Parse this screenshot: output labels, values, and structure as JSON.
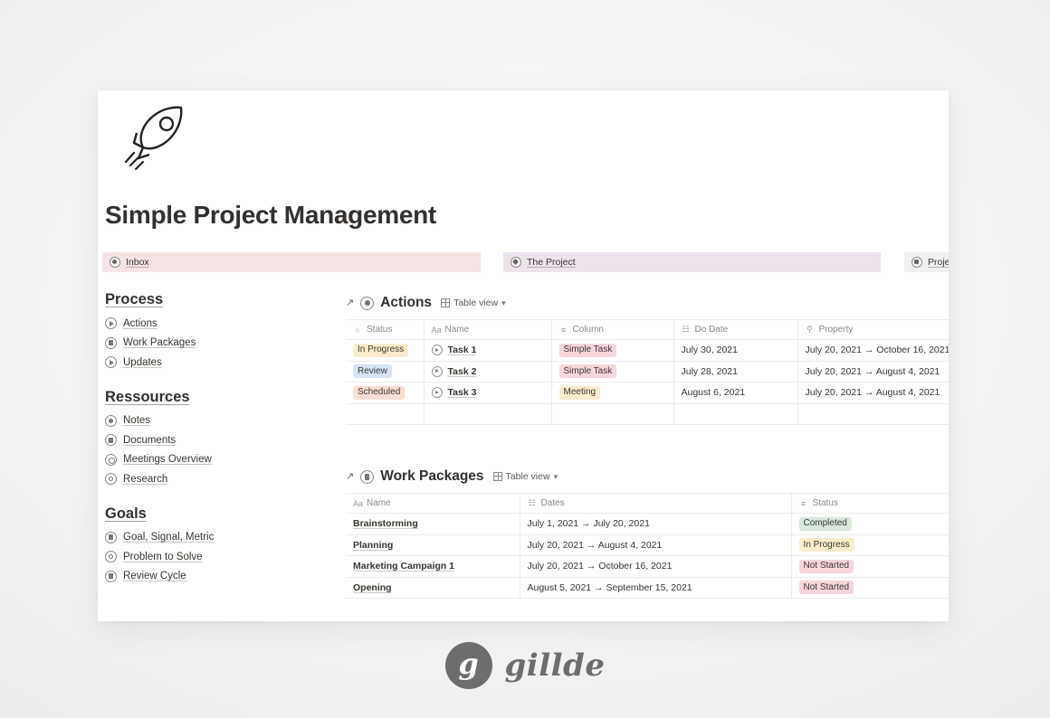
{
  "page": {
    "title": "Simple Project Management",
    "hero_icon": "rocket-icon"
  },
  "callouts": [
    {
      "label": "Inbox",
      "icon": "circle-eye-icon",
      "bg": "#f6e4e4"
    },
    {
      "label": "The Project",
      "icon": "circle-target-icon",
      "bg": "#eee3ec"
    },
    {
      "label": "Projec",
      "icon": "circle-person-icon",
      "bg": "#eef0f2"
    }
  ],
  "sidebar": {
    "groups": [
      {
        "heading": "Process",
        "items": [
          {
            "label": "Actions",
            "icon": "circle-play-icon"
          },
          {
            "label": "Work Packages",
            "icon": "circle-p-icon"
          },
          {
            "label": "Updates",
            "icon": "circle-triangle-icon"
          }
        ]
      },
      {
        "heading": "Ressources",
        "items": [
          {
            "label": "Notes",
            "icon": "circle-note-icon"
          },
          {
            "label": "Documents",
            "icon": "circle-document-icon"
          },
          {
            "label": "Meetings Overview",
            "icon": "circle-clock-icon"
          },
          {
            "label": "Research",
            "icon": "circle-target-icon"
          }
        ]
      },
      {
        "heading": "Goals",
        "items": [
          {
            "label": "Goal, Signal, Metric",
            "icon": "circle-document-icon"
          },
          {
            "label": "Problem to Solve",
            "icon": "circle-target-icon"
          },
          {
            "label": "Review Cycle",
            "icon": "circle-r-icon"
          }
        ]
      }
    ]
  },
  "databases": [
    {
      "title": "Actions",
      "open_icon": "arrow-up-right-icon",
      "db_icon": "circle-play-icon",
      "view": {
        "label": "Table view",
        "icon": "grid-icon",
        "chevron": "chevron-down-icon"
      },
      "columns": [
        {
          "label": "Status",
          "glyph": "○"
        },
        {
          "label": "Name",
          "glyph": "Aa"
        },
        {
          "label": "Column",
          "glyph": "≡"
        },
        {
          "label": "Do Date",
          "glyph": "☷"
        },
        {
          "label": "Property",
          "glyph": "⚲"
        }
      ],
      "rows": [
        {
          "status": {
            "text": "In Progress",
            "tag": "tag-inprogress"
          },
          "name": "Task 1",
          "column": {
            "text": "Simple Task",
            "tag": "tag-simpletask"
          },
          "do_date": "July 30, 2021",
          "property": "July 20, 2021 → October 16, 2021"
        },
        {
          "status": {
            "text": "Review",
            "tag": "tag-review"
          },
          "name": "Task 2",
          "column": {
            "text": "Simple Task",
            "tag": "tag-simpletask"
          },
          "do_date": "July 28, 2021",
          "property": "July 20, 2021 → August 4, 2021"
        },
        {
          "status": {
            "text": "Scheduled",
            "tag": "tag-scheduled"
          },
          "name": "Task 3",
          "column": {
            "text": "Meeting",
            "tag": "tag-meeting"
          },
          "do_date": "August 6, 2021",
          "property": "July 20, 2021 → August 4, 2021"
        }
      ]
    },
    {
      "title": "Work Packages",
      "open_icon": "arrow-up-right-icon",
      "db_icon": "circle-p-icon",
      "view": {
        "label": "Table view",
        "icon": "grid-icon",
        "chevron": "chevron-down-icon"
      },
      "columns": [
        {
          "label": "Name",
          "glyph": "Aa"
        },
        {
          "label": "Dates",
          "glyph": "☷"
        },
        {
          "label": "Status",
          "glyph": "≡"
        }
      ],
      "rows": [
        {
          "name": "Brainstorming",
          "dates": "July 1, 2021 → July 20, 2021",
          "status": {
            "text": "Completed",
            "tag": "tag-completed"
          }
        },
        {
          "name": "Planning",
          "dates": "July 20, 2021 → August 4, 2021",
          "status": {
            "text": "In Progress",
            "tag": "tag-inprogress"
          }
        },
        {
          "name": "Marketing Campaign 1",
          "dates": "July 20, 2021 → October 16, 2021",
          "status": {
            "text": "Not Started",
            "tag": "tag-notstarted"
          }
        },
        {
          "name": "Opening",
          "dates": "August 5, 2021 → September 15, 2021",
          "status": {
            "text": "Not Started",
            "tag": "tag-notstarted"
          }
        }
      ]
    }
  ],
  "footer": {
    "brand_mark": "g",
    "brand_name": "gillde"
  }
}
